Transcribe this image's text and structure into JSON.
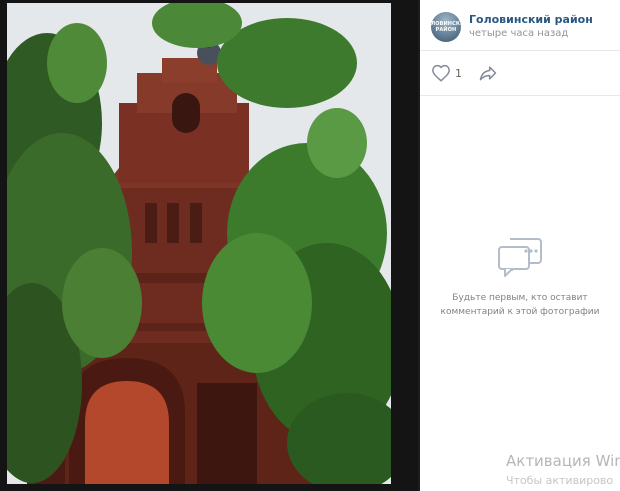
{
  "post": {
    "group_name": "Головинский район",
    "time": "четыре часа назад",
    "avatar_text": "ГОЛОВИНСКИЙ РАЙОН",
    "likes": "1"
  },
  "icons": {
    "like": "heart-icon",
    "share": "share-arrow-icon",
    "comment": "comment-bubble-icon"
  },
  "comments": {
    "empty_line1": "Будьте первым, кто оставит",
    "empty_line2": "комментарий к этой фотографии"
  },
  "watermark": {
    "title": "Активация Win",
    "subtitle": "Чтобы активирово"
  },
  "colors": {
    "link": "#2a5885",
    "muted": "#939393",
    "brick": "#7a3224"
  }
}
